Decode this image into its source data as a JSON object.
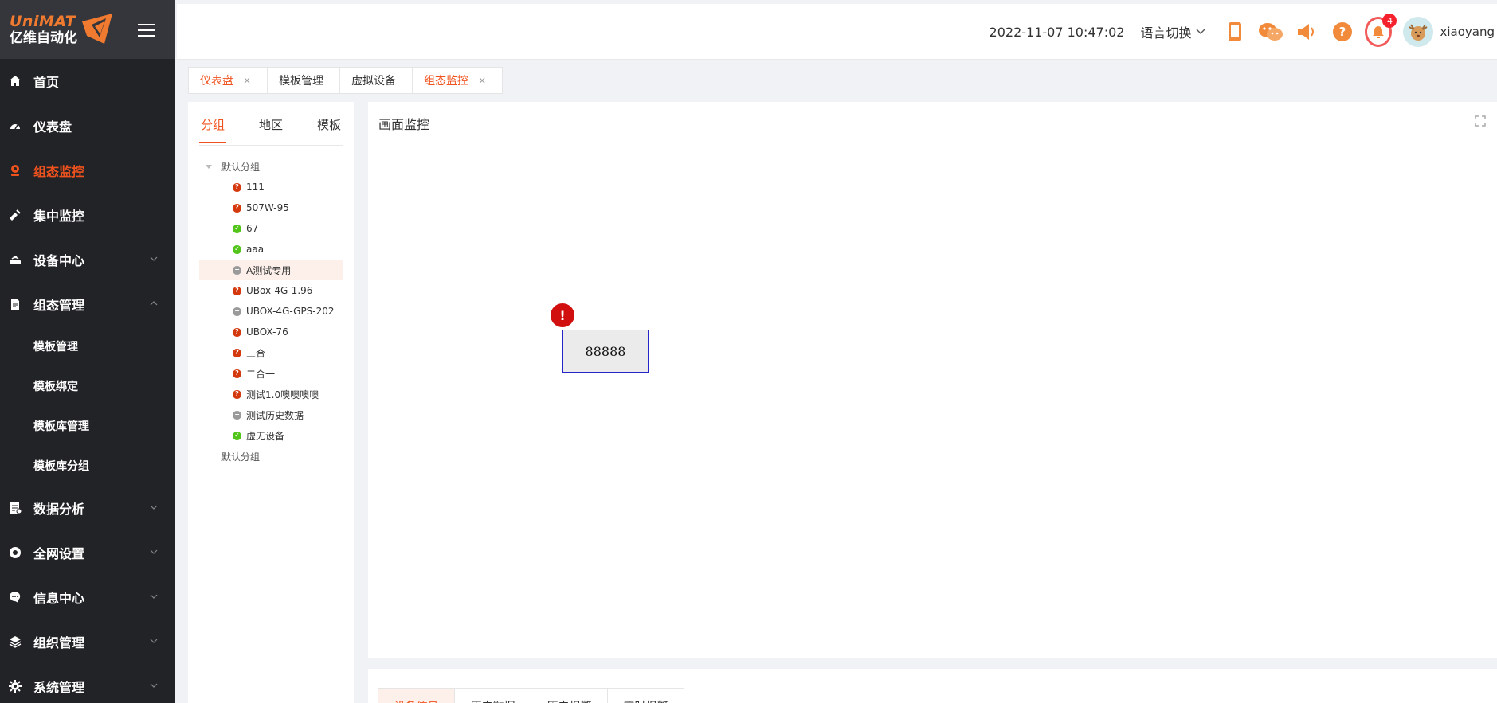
{
  "logo": {
    "en": "UniMAT",
    "cn": "亿维自动化"
  },
  "sidebar": {
    "items": [
      {
        "label": "首页",
        "icon": "home-icon"
      },
      {
        "label": "仪表盘",
        "icon": "dashboard-icon"
      },
      {
        "label": "组态监控",
        "icon": "webcam-icon",
        "active": true
      },
      {
        "label": "集中监控",
        "icon": "satellite-icon"
      },
      {
        "label": "设备中心",
        "icon": "router-icon",
        "expandable": true
      },
      {
        "label": "组态管理",
        "icon": "document-icon",
        "expanded": true
      }
    ],
    "sub_items": [
      "模板管理",
      "模板绑定",
      "模板库管理",
      "模板库分组"
    ],
    "items_after": [
      {
        "label": "数据分析",
        "icon": "report-icon"
      },
      {
        "label": "全网设置",
        "icon": "network-icon"
      },
      {
        "label": "信息中心",
        "icon": "chat-icon"
      },
      {
        "label": "组织管理",
        "icon": "layers-icon"
      },
      {
        "label": "系统管理",
        "icon": "gear-icon"
      }
    ]
  },
  "header": {
    "datetime": "2022-11-07 10:47:02",
    "language": "语言切换",
    "alarm_count": "4",
    "username": "xiaoyang"
  },
  "tabs": [
    {
      "label": "仪表盘",
      "closable": true,
      "highlight": true
    },
    {
      "label": "模板管理",
      "closable": false,
      "highlight": false
    },
    {
      "label": "虚拟设备",
      "closable": false,
      "highlight": false
    },
    {
      "label": "组态监控",
      "closable": true,
      "highlight": true
    }
  ],
  "close_glyph": "×",
  "left_panel": {
    "tabs": [
      "分组",
      "地区",
      "模板"
    ],
    "group_name": "默认分组",
    "devices": [
      {
        "name": "111",
        "status": "err"
      },
      {
        "name": "507W-95",
        "status": "err"
      },
      {
        "name": "67",
        "status": "ok"
      },
      {
        "name": "aaa",
        "status": "ok"
      },
      {
        "name": "A测试专用",
        "status": "off",
        "selected": true
      },
      {
        "name": "UBox-4G-1.96",
        "status": "err"
      },
      {
        "name": "UBOX-4G-GPS-202",
        "status": "off"
      },
      {
        "name": "UBOX-76",
        "status": "err"
      },
      {
        "name": "三合一",
        "status": "err"
      },
      {
        "name": "二合一",
        "status": "err"
      },
      {
        "name": "测试1.0噢噢噢噢",
        "status": "err"
      },
      {
        "name": "测试历史数据",
        "status": "off"
      },
      {
        "name": "虚无设备",
        "status": "ok"
      }
    ],
    "second_group": "默认分组"
  },
  "monitor": {
    "title": "画面监控",
    "alert_symbol": "!",
    "value": "88888"
  },
  "bottom_tabs": [
    "设备信息",
    "历史数据",
    "历史报警",
    "实时报警"
  ],
  "colors": {
    "accent": "#f0521d",
    "sidebar_bg": "#222327",
    "error": "#d4380d",
    "ok": "#52c41a",
    "offline": "#9a9a9a"
  }
}
